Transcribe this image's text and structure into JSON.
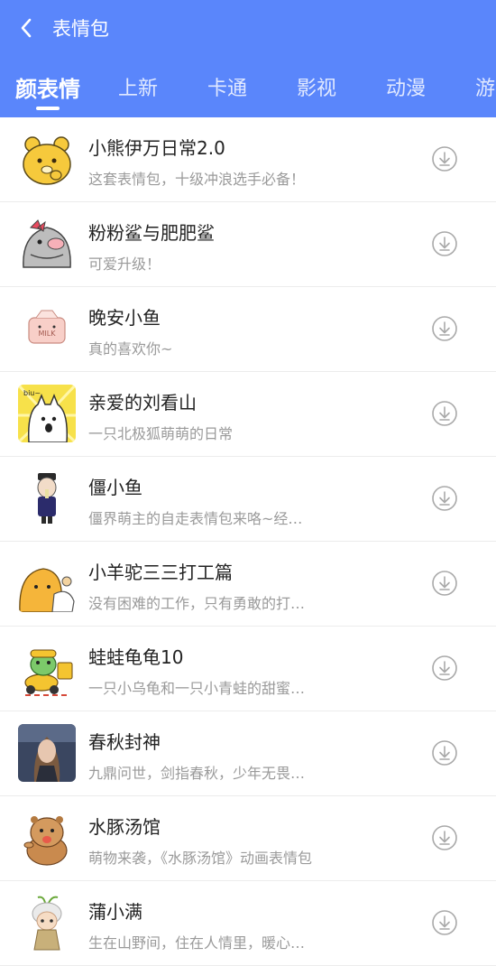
{
  "header": {
    "title": "表情包"
  },
  "tabs": [
    "颜表情",
    "上新",
    "卡通",
    "影视",
    "动漫",
    "游"
  ],
  "items": [
    {
      "name": "小熊伊万日常2.0",
      "desc": "这套表情包，十级冲浪选手必备！"
    },
    {
      "name": "粉粉鲨与肥肥鲨",
      "desc": "可爱升级！"
    },
    {
      "name": "晚安小鱼",
      "desc": "真的喜欢你~"
    },
    {
      "name": "亲爱的刘看山",
      "desc": "一只北极狐萌萌的日常"
    },
    {
      "name": "僵小鱼",
      "desc": "僵界萌主的自走表情包来咯~经…"
    },
    {
      "name": "小羊驼三三打工篇",
      "desc": "没有困难的工作，只有勇敢的打…"
    },
    {
      "name": "蛙蛙龟龟10",
      "desc": "一只小乌龟和一只小青蛙的甜蜜…"
    },
    {
      "name": "春秋封神",
      "desc": "九鼎问世，剑指春秋，少年无畏…"
    },
    {
      "name": "水豚汤馆",
      "desc": "萌物来袭，《水豚汤馆》动画表情包"
    },
    {
      "name": "蒲小满",
      "desc": "生在山野间，住在人情里，暖心…"
    }
  ],
  "thumb_texts": {
    "bear_sign": "biu~",
    "milk_box": "MILK"
  },
  "colors": {
    "header_bg": "#5a86fb",
    "text_primary": "#222222",
    "text_secondary": "#9a9a9a"
  },
  "icons": {
    "back": "chevron-left-icon",
    "download": "download-circle-icon"
  }
}
